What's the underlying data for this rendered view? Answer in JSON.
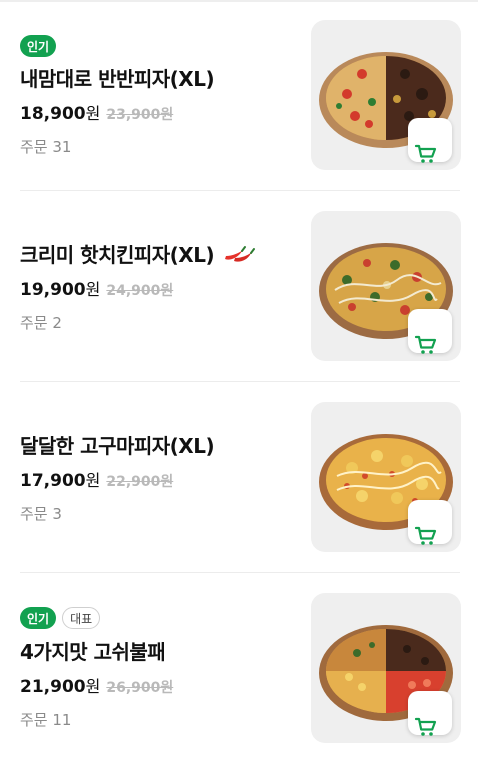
{
  "colors": {
    "accent_green": "#12a150",
    "original_price_gray": "#b9b9b9",
    "orders_gray": "#8a8a8a"
  },
  "items": [
    {
      "badges": [
        "인기"
      ],
      "title": "내맘대로 반반피자(XL)",
      "price": "18,900",
      "currency": "원",
      "original_price": "23,900원",
      "orders": "주문 31",
      "cart_icon": "cart-icon"
    },
    {
      "badges": [],
      "title": "크리미 핫치킨피자(XL)",
      "spicy_icon": "chili-pepper-icon",
      "price": "19,900",
      "currency": "원",
      "original_price": "24,900원",
      "orders": "주문 2",
      "cart_icon": "cart-icon"
    },
    {
      "badges": [],
      "title": "달달한 고구마피자(XL)",
      "price": "17,900",
      "currency": "원",
      "original_price": "22,900원",
      "orders": "주문 3",
      "cart_icon": "cart-icon"
    },
    {
      "badges": [
        "인기",
        "대표"
      ],
      "title": "4가지맛 고쉬불패",
      "price": "21,900",
      "currency": "원",
      "original_price": "26,900원",
      "orders": "주문 11",
      "cart_icon": "cart-icon"
    }
  ]
}
